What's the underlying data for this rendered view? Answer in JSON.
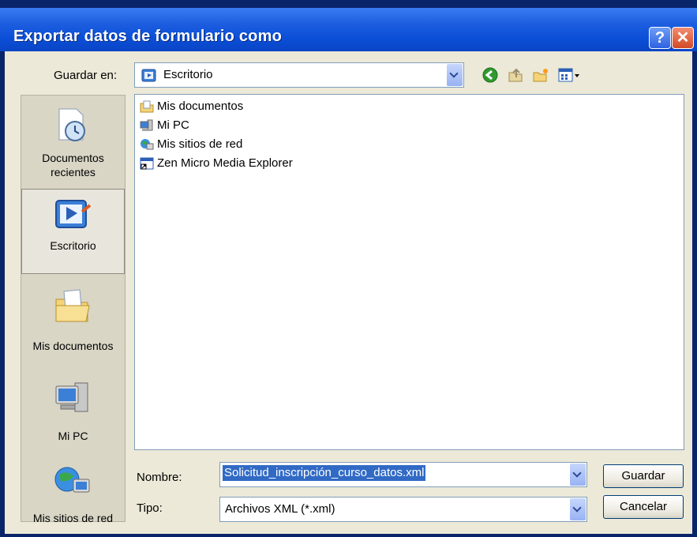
{
  "window": {
    "title": "Exportar datos de formulario como"
  },
  "toolbar": {
    "save_in_label": "Guardar en:",
    "location": "Escritorio"
  },
  "places": [
    {
      "label_line1": "Documentos",
      "label_line2": "recientes"
    },
    {
      "label_line1": "Escritorio",
      "label_line2": ""
    },
    {
      "label_line1": "Mis documentos",
      "label_line2": ""
    },
    {
      "label_line1": "Mi PC",
      "label_line2": ""
    },
    {
      "label_line1": "Mis sitios de red",
      "label_line2": ""
    }
  ],
  "files": [
    {
      "name": "Mis documentos",
      "icon": "folder-documents-icon"
    },
    {
      "name": "Mi PC",
      "icon": "computer-icon"
    },
    {
      "name": "Mis sitios de red",
      "icon": "network-places-icon"
    },
    {
      "name": "Zen Micro Media Explorer",
      "icon": "shortcut-icon"
    }
  ],
  "form": {
    "name_label": "Nombre:",
    "name_value": "Solicitud_inscripción_curso_datos.xml",
    "type_label": "Tipo:",
    "type_value": "Archivos XML (*.xml)"
  },
  "buttons": {
    "save": "Guardar",
    "cancel": "Cancelar"
  },
  "colors": {
    "title_bar": "#0b4fd8",
    "dialog_bg": "#ece9d8",
    "selection": "#316ac5"
  }
}
